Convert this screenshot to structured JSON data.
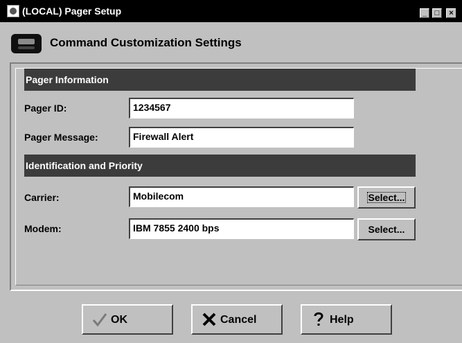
{
  "window": {
    "title": "(LOCAL) Pager Setup",
    "minimize_glyph": "_",
    "maximize_glyph": "□",
    "close_glyph": "×"
  },
  "header": {
    "title": "Command Customization Settings",
    "icon": "pager-icon"
  },
  "sections": {
    "pager_info": "Pager Information",
    "id_priority": "Identification and Priority"
  },
  "fields": {
    "pager_id": {
      "label": "Pager ID:",
      "value": "1234567"
    },
    "pager_message": {
      "label": "Pager Message:",
      "value": "Firewall Alert"
    },
    "carrier": {
      "label": "Carrier:",
      "value": "Mobilecom",
      "button": "Select..."
    },
    "modem": {
      "label": "Modem:",
      "value": "IBM 7855 2400 bps",
      "button": "Select..."
    }
  },
  "buttons": {
    "ok": "OK",
    "cancel": "Cancel",
    "help": "Help"
  },
  "colors": {
    "title_bar": "#000000",
    "section_header": "#3c3c3c",
    "face": "#c0c0c0"
  }
}
